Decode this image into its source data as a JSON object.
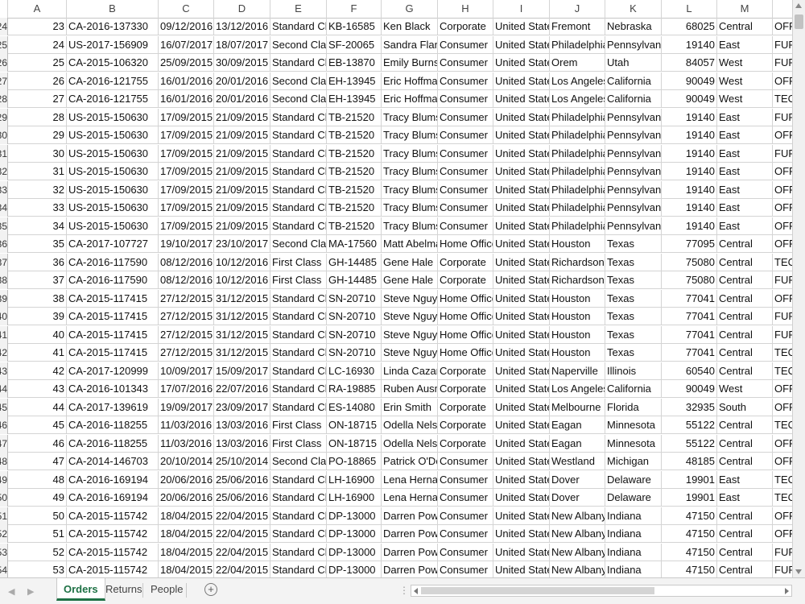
{
  "columns": [
    "A",
    "B",
    "C",
    "D",
    "E",
    "F",
    "G",
    "H",
    "I",
    "J",
    "K",
    "L",
    "M"
  ],
  "rows": [
    {
      "rn": "24",
      "c": [
        "23",
        "CA-2016-137330",
        "09/12/2016",
        "13/12/2016",
        "Standard Clas",
        "KB-16585",
        "Ken Black",
        "Corporate",
        "United States",
        "Fremont",
        "Nebraska",
        "68025",
        "Central",
        "OFF"
      ]
    },
    {
      "rn": "25",
      "c": [
        "24",
        "US-2017-156909",
        "16/07/2017",
        "18/07/2017",
        "Second Class",
        "SF-20065",
        "Sandra Flanag",
        "Consumer",
        "United States",
        "Philadelphia",
        "Pennsylvania",
        "19140",
        "East",
        "FUR"
      ]
    },
    {
      "rn": "26",
      "c": [
        "25",
        "CA-2015-106320",
        "25/09/2015",
        "30/09/2015",
        "Standard Clas",
        "EB-13870",
        "Emily Burns",
        "Consumer",
        "United States",
        "Orem",
        "Utah",
        "84057",
        "West",
        "FUR"
      ]
    },
    {
      "rn": "27",
      "c": [
        "26",
        "CA-2016-121755",
        "16/01/2016",
        "20/01/2016",
        "Second Class",
        "EH-13945",
        "Eric Hoffman",
        "Consumer",
        "United States",
        "Los Angeles",
        "California",
        "90049",
        "West",
        "OFF"
      ]
    },
    {
      "rn": "28",
      "c": [
        "27",
        "CA-2016-121755",
        "16/01/2016",
        "20/01/2016",
        "Second Class",
        "EH-13945",
        "Eric Hoffman",
        "Consumer",
        "United States",
        "Los Angeles",
        "California",
        "90049",
        "West",
        "TEC"
      ]
    },
    {
      "rn": "29",
      "c": [
        "28",
        "US-2015-150630",
        "17/09/2015",
        "21/09/2015",
        "Standard Clas",
        "TB-21520",
        "Tracy Blumst",
        "Consumer",
        "United States",
        "Philadelphia",
        "Pennsylvania",
        "19140",
        "East",
        "FUR"
      ]
    },
    {
      "rn": "30",
      "c": [
        "29",
        "US-2015-150630",
        "17/09/2015",
        "21/09/2015",
        "Standard Clas",
        "TB-21520",
        "Tracy Blumst",
        "Consumer",
        "United States",
        "Philadelphia",
        "Pennsylvania",
        "19140",
        "East",
        "OFF"
      ]
    },
    {
      "rn": "31",
      "c": [
        "30",
        "US-2015-150630",
        "17/09/2015",
        "21/09/2015",
        "Standard Clas",
        "TB-21520",
        "Tracy Blumst",
        "Consumer",
        "United States",
        "Philadelphia",
        "Pennsylvania",
        "19140",
        "East",
        "FUR"
      ]
    },
    {
      "rn": "32",
      "c": [
        "31",
        "US-2015-150630",
        "17/09/2015",
        "21/09/2015",
        "Standard Clas",
        "TB-21520",
        "Tracy Blumst",
        "Consumer",
        "United States",
        "Philadelphia",
        "Pennsylvania",
        "19140",
        "East",
        "OFF"
      ]
    },
    {
      "rn": "33",
      "c": [
        "32",
        "US-2015-150630",
        "17/09/2015",
        "21/09/2015",
        "Standard Clas",
        "TB-21520",
        "Tracy Blumst",
        "Consumer",
        "United States",
        "Philadelphia",
        "Pennsylvania",
        "19140",
        "East",
        "OFF"
      ]
    },
    {
      "rn": "34",
      "c": [
        "33",
        "US-2015-150630",
        "17/09/2015",
        "21/09/2015",
        "Standard Clas",
        "TB-21520",
        "Tracy Blumst",
        "Consumer",
        "United States",
        "Philadelphia",
        "Pennsylvania",
        "19140",
        "East",
        "OFF"
      ]
    },
    {
      "rn": "35",
      "c": [
        "34",
        "US-2015-150630",
        "17/09/2015",
        "21/09/2015",
        "Standard Clas",
        "TB-21520",
        "Tracy Blumst",
        "Consumer",
        "United States",
        "Philadelphia",
        "Pennsylvania",
        "19140",
        "East",
        "OFF"
      ]
    },
    {
      "rn": "36",
      "c": [
        "35",
        "CA-2017-107727",
        "19/10/2017",
        "23/10/2017",
        "Second Class",
        "MA-17560",
        "Matt Abelma",
        "Home Office",
        "United States",
        "Houston",
        "Texas",
        "77095",
        "Central",
        "OFF"
      ]
    },
    {
      "rn": "37",
      "c": [
        "36",
        "CA-2016-117590",
        "08/12/2016",
        "10/12/2016",
        "First Class",
        "GH-14485",
        "Gene Hale",
        "Corporate",
        "United States",
        "Richardson",
        "Texas",
        "75080",
        "Central",
        "TEC"
      ]
    },
    {
      "rn": "38",
      "c": [
        "37",
        "CA-2016-117590",
        "08/12/2016",
        "10/12/2016",
        "First Class",
        "GH-14485",
        "Gene Hale",
        "Corporate",
        "United States",
        "Richardson",
        "Texas",
        "75080",
        "Central",
        "FUR"
      ]
    },
    {
      "rn": "39",
      "c": [
        "38",
        "CA-2015-117415",
        "27/12/2015",
        "31/12/2015",
        "Standard Clas",
        "SN-20710",
        "Steve Nguyer",
        "Home Office",
        "United States",
        "Houston",
        "Texas",
        "77041",
        "Central",
        "OFF"
      ]
    },
    {
      "rn": "40",
      "c": [
        "39",
        "CA-2015-117415",
        "27/12/2015",
        "31/12/2015",
        "Standard Clas",
        "SN-20710",
        "Steve Nguyer",
        "Home Office",
        "United States",
        "Houston",
        "Texas",
        "77041",
        "Central",
        "FUR"
      ]
    },
    {
      "rn": "41",
      "c": [
        "40",
        "CA-2015-117415",
        "27/12/2015",
        "31/12/2015",
        "Standard Clas",
        "SN-20710",
        "Steve Nguyer",
        "Home Office",
        "United States",
        "Houston",
        "Texas",
        "77041",
        "Central",
        "FUR"
      ]
    },
    {
      "rn": "42",
      "c": [
        "41",
        "CA-2015-117415",
        "27/12/2015",
        "31/12/2015",
        "Standard Clas",
        "SN-20710",
        "Steve Nguyer",
        "Home Office",
        "United States",
        "Houston",
        "Texas",
        "77041",
        "Central",
        "TEC"
      ]
    },
    {
      "rn": "43",
      "c": [
        "42",
        "CA-2017-120999",
        "10/09/2017",
        "15/09/2017",
        "Standard Clas",
        "LC-16930",
        "Linda Cazami",
        "Corporate",
        "United States",
        "Naperville",
        "Illinois",
        "60540",
        "Central",
        "TEC"
      ]
    },
    {
      "rn": "44",
      "c": [
        "43",
        "CA-2016-101343",
        "17/07/2016",
        "22/07/2016",
        "Standard Clas",
        "RA-19885",
        "Ruben Ausma",
        "Corporate",
        "United States",
        "Los Angeles",
        "California",
        "90049",
        "West",
        "OFF"
      ]
    },
    {
      "rn": "45",
      "c": [
        "44",
        "CA-2017-139619",
        "19/09/2017",
        "23/09/2017",
        "Standard Clas",
        "ES-14080",
        "Erin Smith",
        "Corporate",
        "United States",
        "Melbourne",
        "Florida",
        "32935",
        "South",
        "OFF"
      ]
    },
    {
      "rn": "46",
      "c": [
        "45",
        "CA-2016-118255",
        "11/03/2016",
        "13/03/2016",
        "First Class",
        "ON-18715",
        "Odella Nelso",
        "Corporate",
        "United States",
        "Eagan",
        "Minnesota",
        "55122",
        "Central",
        "TEC"
      ]
    },
    {
      "rn": "47",
      "c": [
        "46",
        "CA-2016-118255",
        "11/03/2016",
        "13/03/2016",
        "First Class",
        "ON-18715",
        "Odella Nelso",
        "Corporate",
        "United States",
        "Eagan",
        "Minnesota",
        "55122",
        "Central",
        "OFF"
      ]
    },
    {
      "rn": "48",
      "c": [
        "47",
        "CA-2014-146703",
        "20/10/2014",
        "25/10/2014",
        "Second Class",
        "PO-18865",
        "Patrick O'Dor",
        "Consumer",
        "United States",
        "Westland",
        "Michigan",
        "48185",
        "Central",
        "OFF"
      ]
    },
    {
      "rn": "49",
      "c": [
        "48",
        "CA-2016-169194",
        "20/06/2016",
        "25/06/2016",
        "Standard Clas",
        "LH-16900",
        "Lena Hernanc",
        "Consumer",
        "United States",
        "Dover",
        "Delaware",
        "19901",
        "East",
        "TEC"
      ]
    },
    {
      "rn": "50",
      "c": [
        "49",
        "CA-2016-169194",
        "20/06/2016",
        "25/06/2016",
        "Standard Clas",
        "LH-16900",
        "Lena Hernanc",
        "Consumer",
        "United States",
        "Dover",
        "Delaware",
        "19901",
        "East",
        "TEC"
      ]
    },
    {
      "rn": "51",
      "c": [
        "50",
        "CA-2015-115742",
        "18/04/2015",
        "22/04/2015",
        "Standard Clas",
        "DP-13000",
        "Darren Powel",
        "Consumer",
        "United States",
        "New Albany",
        "Indiana",
        "47150",
        "Central",
        "OFF"
      ]
    },
    {
      "rn": "52",
      "c": [
        "51",
        "CA-2015-115742",
        "18/04/2015",
        "22/04/2015",
        "Standard Clas",
        "DP-13000",
        "Darren Powel",
        "Consumer",
        "United States",
        "New Albany",
        "Indiana",
        "47150",
        "Central",
        "OFF"
      ]
    },
    {
      "rn": "53",
      "c": [
        "52",
        "CA-2015-115742",
        "18/04/2015",
        "22/04/2015",
        "Standard Clas",
        "DP-13000",
        "Darren Powel",
        "Consumer",
        "United States",
        "New Albany",
        "Indiana",
        "47150",
        "Central",
        "FUR"
      ]
    },
    {
      "rn": "54",
      "c": [
        "53",
        "CA-2015-115742",
        "18/04/2015",
        "22/04/2015",
        "Standard Clas",
        "DP-13000",
        "Darren Powel",
        "Consumer",
        "United States",
        "New Albany",
        "Indiana",
        "47150",
        "Central",
        "FUR"
      ]
    }
  ],
  "tabs": {
    "orders": "Orders",
    "returns": "Returns",
    "people": "People",
    "add_symbol": "+",
    "scroll_left": "◀",
    "scroll_right": "▶",
    "dots": "⋮"
  },
  "colors": {
    "active_tab": "#1e7145",
    "grid": "#d4d4d4"
  }
}
